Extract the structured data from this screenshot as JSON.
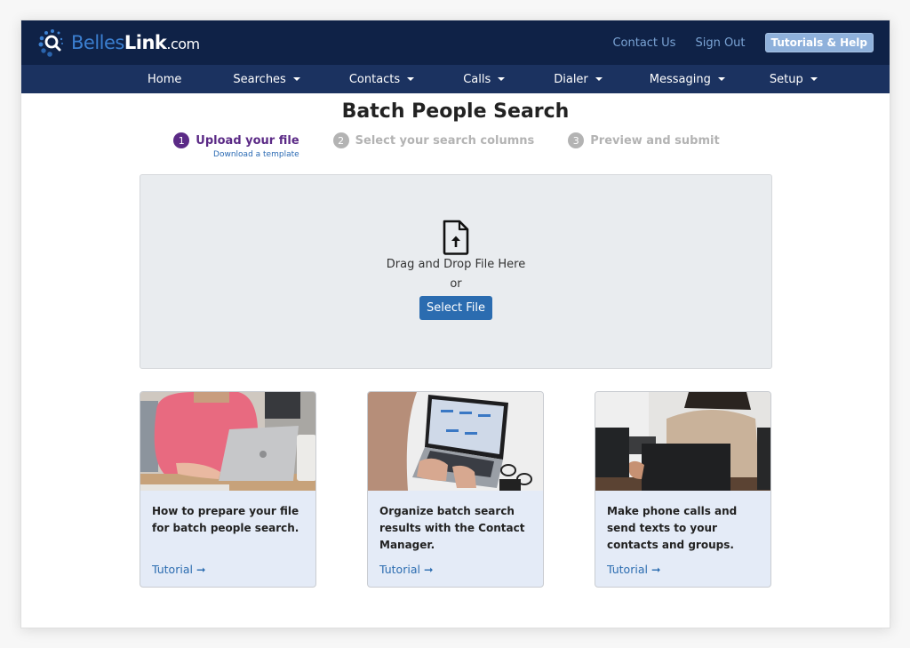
{
  "brand": {
    "name_part1": "Belles",
    "name_part2": "Link",
    "name_part3": ".com",
    "colors": {
      "nav_dark": "#0f2247",
      "nav_secondary": "#1b3260",
      "accent_blue": "#2b6cb0",
      "step_active": "#5b2a86"
    }
  },
  "top_links": {
    "contact": "Contact Us",
    "signout": "Sign Out",
    "help": "Tutorials & Help"
  },
  "nav": {
    "items": [
      {
        "label": "Home",
        "dropdown": false
      },
      {
        "label": "Searches",
        "dropdown": true
      },
      {
        "label": "Contacts",
        "dropdown": true
      },
      {
        "label": "Calls",
        "dropdown": true
      },
      {
        "label": "Dialer",
        "dropdown": true
      },
      {
        "label": "Messaging",
        "dropdown": true
      },
      {
        "label": "Setup",
        "dropdown": true
      }
    ]
  },
  "page": {
    "title": "Batch People Search"
  },
  "steps": [
    {
      "num": "1",
      "label": "Upload your file",
      "sub": "Download a template",
      "state": "active"
    },
    {
      "num": "2",
      "label": "Select your search columns",
      "state": "inactive"
    },
    {
      "num": "3",
      "label": "Preview and submit",
      "state": "inactive"
    }
  ],
  "upload": {
    "icon": "file-upload-icon",
    "drop_text": "Drag and Drop File Here",
    "or_text": "or",
    "button": "Select File"
  },
  "cards": [
    {
      "image": "woman-pink-sweater-laptop-photo",
      "text": "How to prepare your file for batch people search.",
      "link": "Tutorial",
      "link_icon": "arrow-right-icon"
    },
    {
      "image": "hands-typing-laptop-photo",
      "text": "Organize batch search results with the Contact Manager.",
      "link": "Tutorial",
      "link_icon": "arrow-right-icon"
    },
    {
      "image": "woman-tablet-table-photo",
      "text": "Make phone calls and send texts to your contacts and groups.",
      "link": "Tutorial",
      "link_icon": "arrow-right-icon"
    }
  ]
}
